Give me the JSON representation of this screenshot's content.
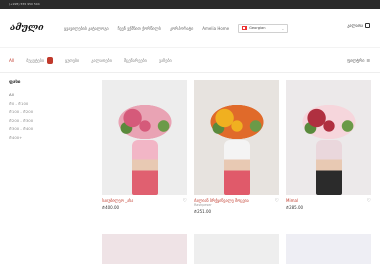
{
  "topbar": {
    "phone": "(+995) 555 950 504"
  },
  "header": {
    "logo": "ამული",
    "nav": [
      "ყვავილების კატალოგი",
      "ჩვენ ვქმნით ქორწილს",
      "კორპორატი",
      "Amelia Home"
    ],
    "language": "Georgian",
    "cart_label": "კალათა"
  },
  "categories": {
    "items": [
      "All",
      "ბუკეტები",
      "ყუთები",
      "კალათები",
      "მცენარეები",
      "ვაზები"
    ],
    "active_index": 0,
    "filter_label": "ფილტრი"
  },
  "sidebar": {
    "heading": "ფასი",
    "filters": [
      "All",
      "₾0 - ₾100",
      "₾100 - ₾200",
      "₾200 - ₾300",
      "₾300 - ₾400",
      "₾400+"
    ]
  },
  "products": [
    {
      "title": "საიუბილეო _ახა",
      "subtitle": "",
      "price": "₾400.00",
      "colors": {
        "bg": "#ededed",
        "flower1": "#d55a7a",
        "flower2": "#e9a3b4",
        "vase": "#f2b6c6",
        "skirt": "#e06070"
      }
    },
    {
      "title": "ძალიან ბრჭყინვალე მოცვია",
      "subtitle": "Rashpeser",
      "price": "₾251.00",
      "colors": {
        "bg": "#e7e3df",
        "flower1": "#f0b020",
        "flower2": "#e06a2a",
        "vase": "#f4f4f4",
        "skirt": "#e05a6a"
      }
    },
    {
      "title": "Mimal",
      "subtitle": "",
      "price": "₾285.00",
      "colors": {
        "bg": "#ece9ea",
        "flower1": "#b03040",
        "flower2": "#f6d6dc",
        "vase": "#ead7dc",
        "skirt": "#2b2b2b"
      }
    }
  ]
}
